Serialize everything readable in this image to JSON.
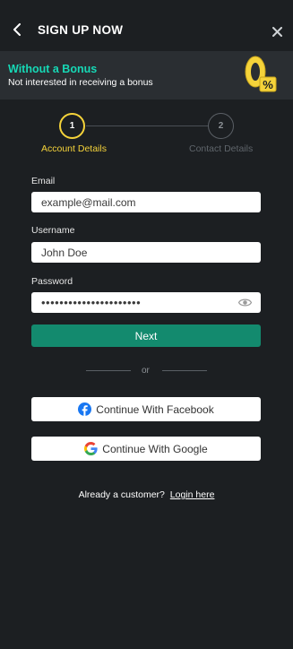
{
  "header": {
    "title": "SIGN UP NOW"
  },
  "banner": {
    "title": "Without a Bonus",
    "subtitle": "Not interested in receiving a bonus",
    "badge_text": "0%"
  },
  "stepper": {
    "steps": [
      {
        "number": "1",
        "label": "Account Details",
        "active": true
      },
      {
        "number": "2",
        "label": "Contact Details",
        "active": false
      }
    ]
  },
  "form": {
    "email": {
      "label": "Email",
      "placeholder": "example@mail.com"
    },
    "username": {
      "label": "Username",
      "placeholder": "John Doe"
    },
    "password": {
      "label": "Password",
      "value": "••••••••••••••••••••••"
    },
    "next_label": "Next",
    "divider_text": "or"
  },
  "social": {
    "facebook_label": "Continue With Facebook",
    "google_label": "Continue With Google"
  },
  "footer": {
    "prompt": "Already a customer?",
    "login_label": "Login here"
  },
  "colors": {
    "background": "#1c1f22",
    "banner": "#2a2e32",
    "accent_teal": "#16d9b6",
    "accent_yellow": "#f5d33a",
    "primary_button": "#138a6e"
  }
}
